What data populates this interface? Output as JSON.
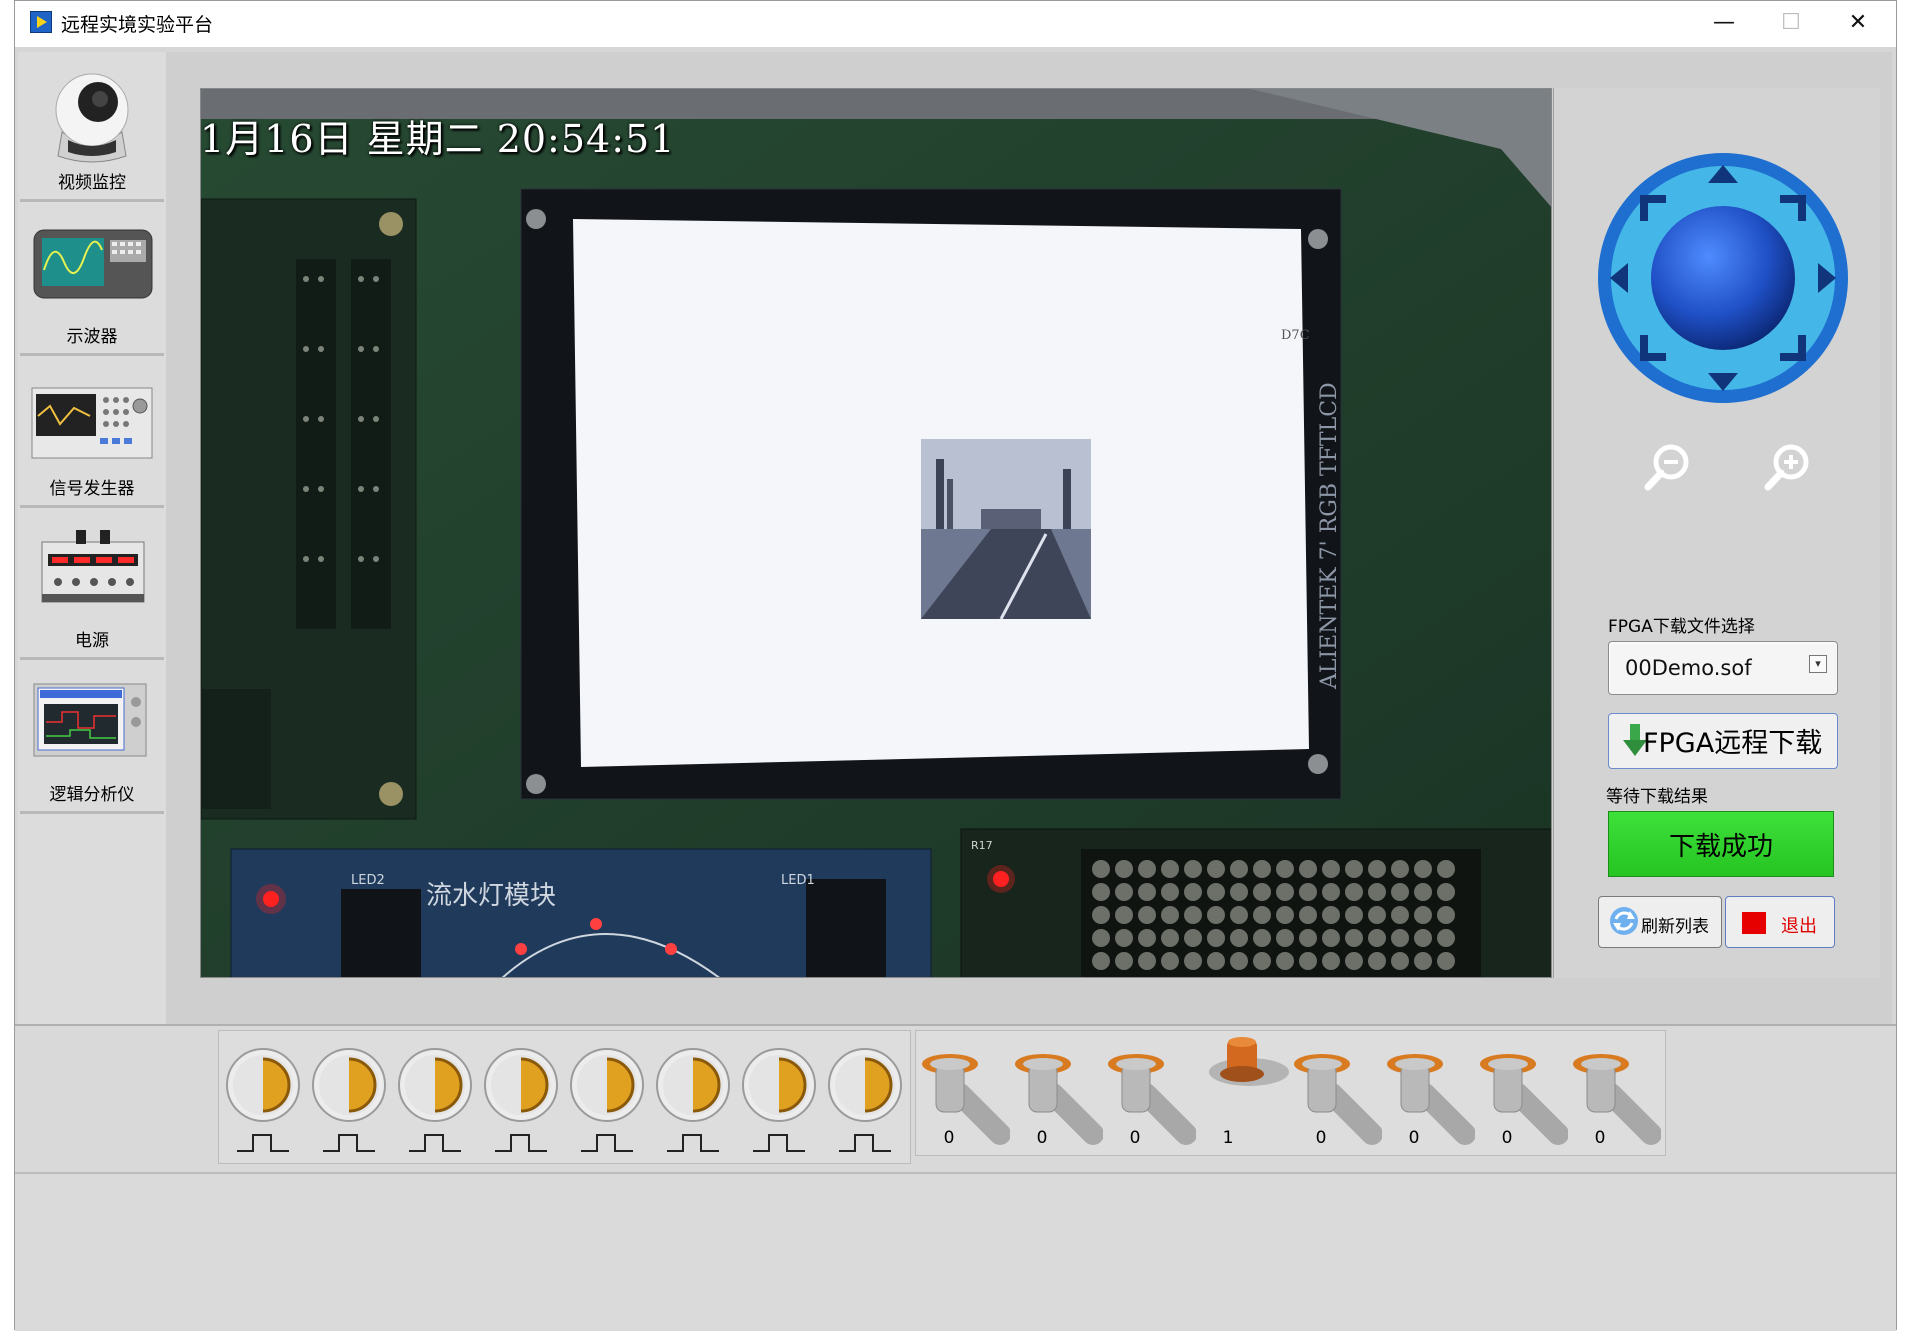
{
  "window": {
    "title": "远程实境实验平台",
    "minimize_glyph": "—",
    "maximize_glyph": "☐",
    "close_glyph": "✕"
  },
  "sidebar": {
    "items": [
      {
        "label": "视频监控",
        "icon": "camera-icon"
      },
      {
        "label": "示波器",
        "icon": "oscilloscope-icon"
      },
      {
        "label": "信号发生器",
        "icon": "signal-generator-icon"
      },
      {
        "label": "电源",
        "icon": "power-supply-icon"
      },
      {
        "label": "逻辑分析仪",
        "icon": "logic-analyzer-icon"
      }
    ]
  },
  "video": {
    "timestamp": "1月16日 星期二 20:54:51",
    "board_labels": {
      "module": "流水灯模块",
      "lcd_text": "ALIENTEK 7' RGB TFTLCD",
      "led1": "LED1",
      "led2": "LED2",
      "r17": "R17"
    }
  },
  "controls": {
    "file_select_label": "FPGA下载文件选择",
    "file_select_value": "00Demo.sof",
    "download_button": "FPGA远程下载",
    "result_label": "等待下载结果",
    "result_text": "下载成功",
    "refresh_button": "刷新列表",
    "exit_button": "退出",
    "colors": {
      "success": "#2ecc2a",
      "exit": "#e60000",
      "ptz": "#1f58c8"
    }
  },
  "bottom": {
    "push_buttons": 8,
    "switch_values": [
      "0",
      "0",
      "0",
      "1",
      "0",
      "0",
      "0",
      "0"
    ]
  }
}
